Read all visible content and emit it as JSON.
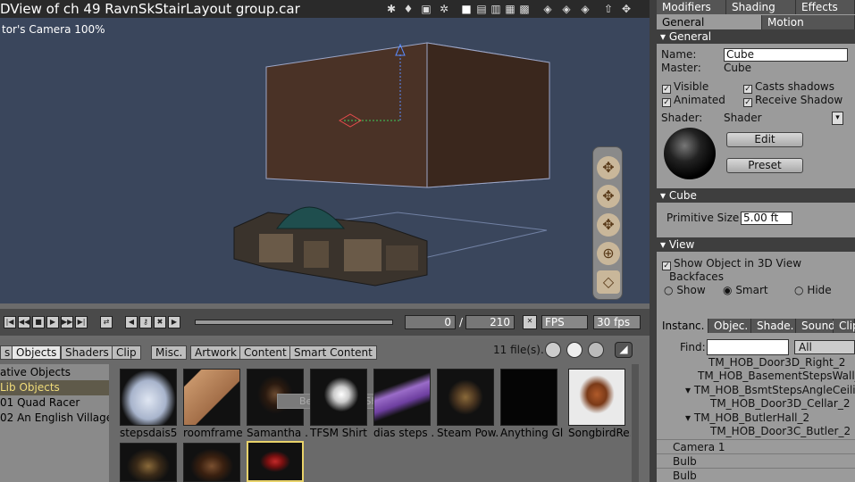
{
  "viewport": {
    "title": "DView of ch 49 RavnSkStairLayout group.car",
    "camera_label": "tor's Camera 100%"
  },
  "properties": {
    "tabs_row1": [
      "Modifiers",
      "Shading",
      "Effects"
    ],
    "tabs_row2": [
      "General",
      "Motion"
    ],
    "general_header": "General",
    "name_label": "Name:",
    "name_value": "Cube",
    "master_label": "Master:",
    "master_value": "Cube",
    "visible": "Visible",
    "casts_shadows": "Casts shadows",
    "animated": "Animated",
    "receive_shadow": "Receive Shadow",
    "shader_label": "Shader:",
    "shader_value": "Shader",
    "edit_button": "Edit",
    "preset_button": "Preset",
    "cube_header": "Cube",
    "primitive_size_label": "Primitive Size",
    "primitive_size_value": "5.00 ft",
    "view_header": "View",
    "show_in_3d": "Show Object in 3D View",
    "backfaces_label": "Backfaces",
    "backfaces_options": [
      "Show",
      "Smart",
      "Hide"
    ],
    "backfaces_selected": "Smart"
  },
  "timeline": {
    "current_frame": "0",
    "separator": "/",
    "total_frames": "210",
    "fps_mode": "FPS",
    "fps_value": "30 fps"
  },
  "browser": {
    "tabs": [
      "s",
      "Objects",
      "Shaders",
      "Clip",
      "Misc.",
      "Artwork",
      "Content",
      "Smart Content"
    ],
    "active_tab": "Objects",
    "file_count": "11 file(s).",
    "categories": [
      "ative Objects",
      "Lib Objects",
      "01 Quad Racer",
      "02 An English Village"
    ],
    "selected_category": "Lib Objects",
    "items": [
      "stepsdais5",
      "roomframe",
      "Samantha .",
      "TFSM Shirt",
      "dias steps .",
      "Steam Pow.",
      "Anything Gl.",
      "SongbirdRe."
    ],
    "watermark": "Best Regular Ship"
  },
  "instances": {
    "tabs": [
      "Instanc.",
      "Objec.",
      "Shade.",
      "Sound.",
      "Clip"
    ],
    "find_label": "Find:",
    "find_value": "",
    "filter_value": "All",
    "rows": [
      {
        "text": "TM_HOB_Door3D_Right_2",
        "indent": 1
      },
      {
        "text": "TM_HOB_BasementStepsWall_",
        "indent": 1
      },
      {
        "text": "TM_HOB_BsmtStepsAngleCeilin",
        "indent": 1,
        "expanded": true
      },
      {
        "text": "TM_HOB_Door3D_Cellar_2",
        "indent": 2
      },
      {
        "text": "TM_HOB_ButlerHall_2",
        "indent": 1,
        "expanded": true
      },
      {
        "text": "TM_HOB_Door3C_Butler_2",
        "indent": 2
      },
      {
        "text": "Camera 1",
        "indent": 0
      },
      {
        "text": "Bulb",
        "indent": 0
      },
      {
        "text": "Bulb",
        "indent": 0
      }
    ]
  }
}
